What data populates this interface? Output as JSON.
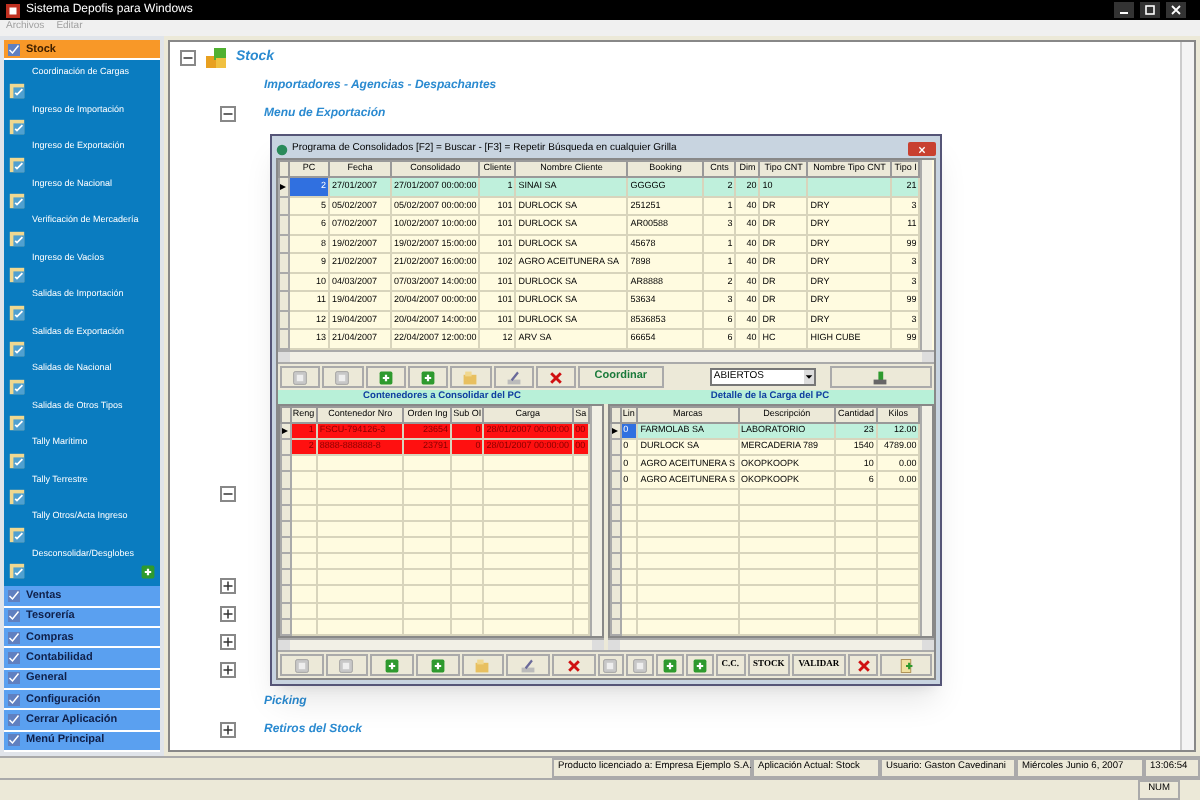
{
  "window": {
    "title": "Sistema Depofis para Windows"
  },
  "menu": [
    {
      "label": "Archivos",
      "disabled": true
    },
    {
      "label": "Editar",
      "disabled": true
    }
  ],
  "sidebar": {
    "groups": [
      {
        "label": "Stock",
        "selected": true,
        "items": [
          "Coordinación de Cargas",
          "Ingreso de Importación",
          "Ingreso de Exportación",
          "Ingreso de Nacional",
          "Verificación de Mercadería",
          "Ingreso de Vacíos",
          "Salidas de Importación",
          "Salidas de Exportación",
          "Salidas de Nacional",
          "Salidas de Otros Tipos",
          "Tally Marítimo",
          "Tally Terrestre",
          "Tally Otros/Acta Ingreso",
          "Desconsolidar/Desglobes"
        ]
      },
      {
        "label": "Ventas",
        "selected": false
      },
      {
        "label": "Tesorería",
        "selected": false
      },
      {
        "label": "Compras",
        "selected": false
      },
      {
        "label": "Contabilidad",
        "selected": false
      },
      {
        "label": "General",
        "selected": false
      },
      {
        "label": "Configuración",
        "selected": false
      },
      {
        "label": "Cerrar Aplicación",
        "selected": false
      },
      {
        "label": "Menú Principal",
        "selected": false
      }
    ]
  },
  "tree": {
    "label": "Stock",
    "expanded": true,
    "children": [
      {
        "label": "Importadores - Agencias - Despachantes"
      },
      {
        "label": "Menu de Exportación",
        "expanded": true
      },
      {
        "expanded": true
      },
      {
        "expanded": false
      },
      {
        "expanded": false
      },
      {
        "expanded": false
      },
      {
        "expanded": false
      },
      {
        "label": "Picking"
      },
      {
        "label": "Retiros del Stock",
        "expanded": false
      }
    ]
  },
  "dialog": {
    "title": "Programa de Consolidados [F2] = Buscar - [F3] = Repetir Búsqueda en cualquier Grilla",
    "grid": {
      "columns": [
        "PC",
        "Fecha",
        "Consolidado",
        "Cliente",
        "Nombre Cliente",
        "Booking",
        "Cnts",
        "Dim",
        "Tipo CNT",
        "Nombre Tipo CNT",
        "Tipo I"
      ],
      "rows": [
        {
          "selected": true,
          "cells": [
            "2",
            "27/01/2007",
            "27/01/2007 00:00:00",
            "1",
            "SINAI SA",
            "GGGGG",
            "2",
            "20",
            "10",
            "",
            "21"
          ]
        },
        {
          "selected": false,
          "cells": [
            "5",
            "05/02/2007",
            "05/02/2007 00:00:00",
            "101",
            "DURLOCK SA",
            "251251",
            "1",
            "40",
            "DR",
            "DRY",
            "3"
          ]
        },
        {
          "selected": false,
          "cells": [
            "6",
            "07/02/2007",
            "10/02/2007 10:00:00",
            "101",
            "DURLOCK SA",
            "AR00588",
            "3",
            "40",
            "DR",
            "DRY",
            "11"
          ]
        },
        {
          "selected": false,
          "cells": [
            "8",
            "19/02/2007",
            "19/02/2007 15:00:00",
            "101",
            "DURLOCK SA",
            "45678",
            "1",
            "40",
            "DR",
            "DRY",
            "99"
          ]
        },
        {
          "selected": false,
          "cells": [
            "9",
            "21/02/2007",
            "21/02/2007 16:00:00",
            "102",
            "AGRO ACEITUNERA SA",
            "7898",
            "1",
            "40",
            "DR",
            "DRY",
            "3"
          ]
        },
        {
          "selected": false,
          "cells": [
            "10",
            "04/03/2007",
            "07/03/2007 14:00:00",
            "101",
            "DURLOCK SA",
            "AR8888",
            "2",
            "40",
            "DR",
            "DRY",
            "3"
          ]
        },
        {
          "selected": false,
          "cells": [
            "11",
            "19/04/2007",
            "20/04/2007 00:00:00",
            "101",
            "DURLOCK SA",
            "53634",
            "3",
            "40",
            "DR",
            "DRY",
            "99"
          ]
        },
        {
          "selected": false,
          "cells": [
            "12",
            "19/04/2007",
            "20/04/2007 14:00:00",
            "101",
            "DURLOCK SA",
            "8536853",
            "6",
            "40",
            "DR",
            "DRY",
            "3"
          ]
        },
        {
          "selected": false,
          "cells": [
            "13",
            "21/04/2007",
            "22/04/2007 12:00:00",
            "12",
            "ARV SA",
            "66654",
            "6",
            "40",
            "HC",
            "HIGH CUBE",
            "99"
          ]
        }
      ]
    },
    "toolbar": {
      "action": "Coordinar",
      "filter": "ABIERTOS"
    },
    "left_title": "Contenedores a Consolidar del PC",
    "right_title": "Detalle de la Carga del PC",
    "containers": {
      "columns": [
        "Reng",
        "Contenedor Nro",
        "Orden Ing",
        "Sub OI",
        "Carga",
        "Sa"
      ],
      "rows": [
        {
          "selected": true,
          "cells": [
            "1",
            "FSCU-794126-3",
            "23654",
            "0",
            "28/01/2007 00:00:00",
            "00"
          ]
        },
        {
          "selected": false,
          "cells": [
            "2",
            "8888-888888-8",
            "23791",
            "0",
            "28/01/2007 00:00:00",
            "00"
          ]
        }
      ]
    },
    "cargo": {
      "columns": [
        "Lin",
        "Marcas",
        "Descripción",
        "Cantidad",
        "Kilos"
      ],
      "rows": [
        {
          "selected": true,
          "cells": [
            "0",
            "FARMOLAB SA",
            "LABORATORIO",
            "23",
            "12.00"
          ]
        },
        {
          "selected": false,
          "cells": [
            "0",
            "DURLOCK SA",
            "MERCADERIA 789",
            "1540",
            "4789.00"
          ]
        },
        {
          "selected": false,
          "cells": [
            "0",
            "AGRO ACEITUNERA S",
            "OKOPKOOPK",
            "10",
            "0.00"
          ]
        },
        {
          "selected": false,
          "cells": [
            "0",
            "AGRO ACEITUNERA S",
            "OKOPKOOPK",
            "6",
            "0.00"
          ]
        }
      ]
    },
    "right_buttons": [
      "C.C.",
      "STOCK",
      "VALIDAR"
    ]
  },
  "status_bar": [
    "Producto licenciado a: Empresa Ejemplo S.A.",
    "Aplicación Actual: Stock",
    "Usuario: Gaston Cavedinani",
    "Miércoles Junio 6, 2007",
    "13:06:54"
  ],
  "indicators": [
    "NUM"
  ]
}
